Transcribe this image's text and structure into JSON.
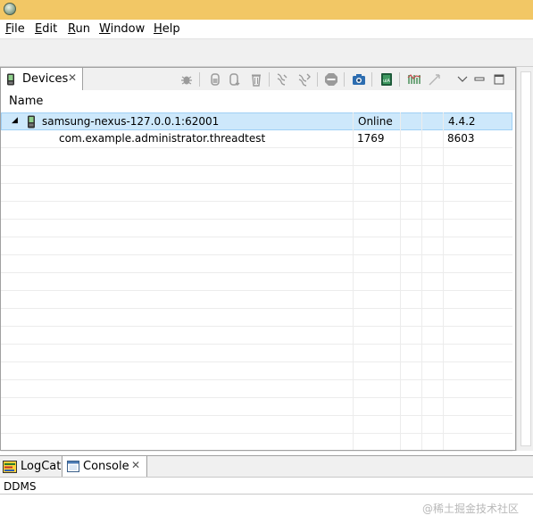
{
  "menu": [
    {
      "mnemonic": "F",
      "rest": "ile"
    },
    {
      "mnemonic": "E",
      "rest": "dit"
    },
    {
      "mnemonic": "R",
      "rest": "un"
    },
    {
      "mnemonic": "W",
      "rest": "indow"
    },
    {
      "mnemonic": "H",
      "rest": "elp"
    }
  ],
  "devices_view": {
    "tab_label": "Devices",
    "column_header": "Name",
    "rows": [
      {
        "name": "samsung-nexus-127.0.0.1:62001",
        "status": "Online",
        "col3": "",
        "col4": "",
        "extra": "4.4.2",
        "selected": true
      },
      {
        "name": "com.example.administrator.threadtest",
        "status": "1769",
        "col3": "",
        "col4": "",
        "extra": "8603",
        "selected": false
      }
    ]
  },
  "bottom_panel": {
    "tabs": [
      {
        "label": "LogCat",
        "active": false
      },
      {
        "label": "Console",
        "active": true
      }
    ],
    "console_title": "DDMS"
  },
  "watermark": "@稀土掘金技术社区",
  "colors": {
    "titlebar": "#f2c765",
    "selection": "#cde8fb",
    "grid_line": "#ececec"
  }
}
